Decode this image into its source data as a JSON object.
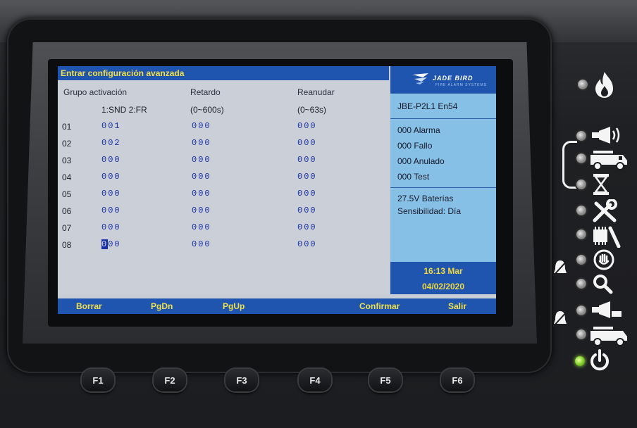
{
  "screen": {
    "title": "Entrar configuración avanzada",
    "columns": {
      "group": "Grupo activación",
      "delay": "Retardo",
      "resume": "Reanudar"
    },
    "subheaders": {
      "group": "1:SND 2:FR",
      "delay": "(0~600s)",
      "resume": "(0~63s)"
    },
    "rows": [
      {
        "num": "01",
        "group": "001",
        "delay": "000",
        "resume": "000"
      },
      {
        "num": "02",
        "group": "002",
        "delay": "000",
        "resume": "000"
      },
      {
        "num": "03",
        "group": "000",
        "delay": "000",
        "resume": "000"
      },
      {
        "num": "04",
        "group": "000",
        "delay": "000",
        "resume": "000"
      },
      {
        "num": "05",
        "group": "000",
        "delay": "000",
        "resume": "000"
      },
      {
        "num": "06",
        "group": "000",
        "delay": "000",
        "resume": "000"
      },
      {
        "num": "07",
        "group": "000",
        "delay": "000",
        "resume": "000"
      },
      {
        "num": "08",
        "group_cursor": "0",
        "group_rest": "00",
        "delay": "000",
        "resume": "000"
      }
    ],
    "sidebar": {
      "brand": "JADE BIRD",
      "brand_tag": "FIRE ALARM SYSTEMS",
      "model": "JBE-P2L1 En54",
      "counters": [
        "000 Alarma",
        "000 Fallo",
        "000 Anulado",
        "000 Test"
      ],
      "battery": "27.5V Baterías",
      "sensitivity": "Sensibilidad: Día",
      "time": "16:13 Mar",
      "date": "04/02/2020"
    },
    "function_bar": {
      "f1": "Borrar",
      "f2": "PgDn",
      "f3": "PgUp",
      "f5": "Confirmar",
      "f6": "Salir"
    }
  },
  "hardware_keys": [
    "F1",
    "F2",
    "F3",
    "F4",
    "F5",
    "F6"
  ],
  "colors": {
    "screen_blue": "#1f55ae",
    "label_yellow": "#f1e04a",
    "value_blue": "#1932a8",
    "side_panel": "#87c0e6",
    "power_led": "#8ed832"
  },
  "indicators": [
    {
      "icon": "fire-icon",
      "led": "off"
    },
    {
      "icon": "siren-icon",
      "led": "off"
    },
    {
      "icon": "fire-truck-icon",
      "led": "off"
    },
    {
      "icon": "hourglass-icon",
      "led": "off"
    },
    {
      "icon": "tools-fault-icon",
      "led": "off"
    },
    {
      "icon": "module-fault-icon",
      "led": "off"
    },
    {
      "icon": "stop-disabled-icon",
      "led": "off"
    },
    {
      "icon": "test-search-icon",
      "led": "off"
    },
    {
      "icon": "siren-disabled-icon",
      "led": "off"
    },
    {
      "icon": "fire-truck-disabled-icon",
      "led": "off"
    },
    {
      "icon": "power-icon",
      "led": "on"
    }
  ]
}
